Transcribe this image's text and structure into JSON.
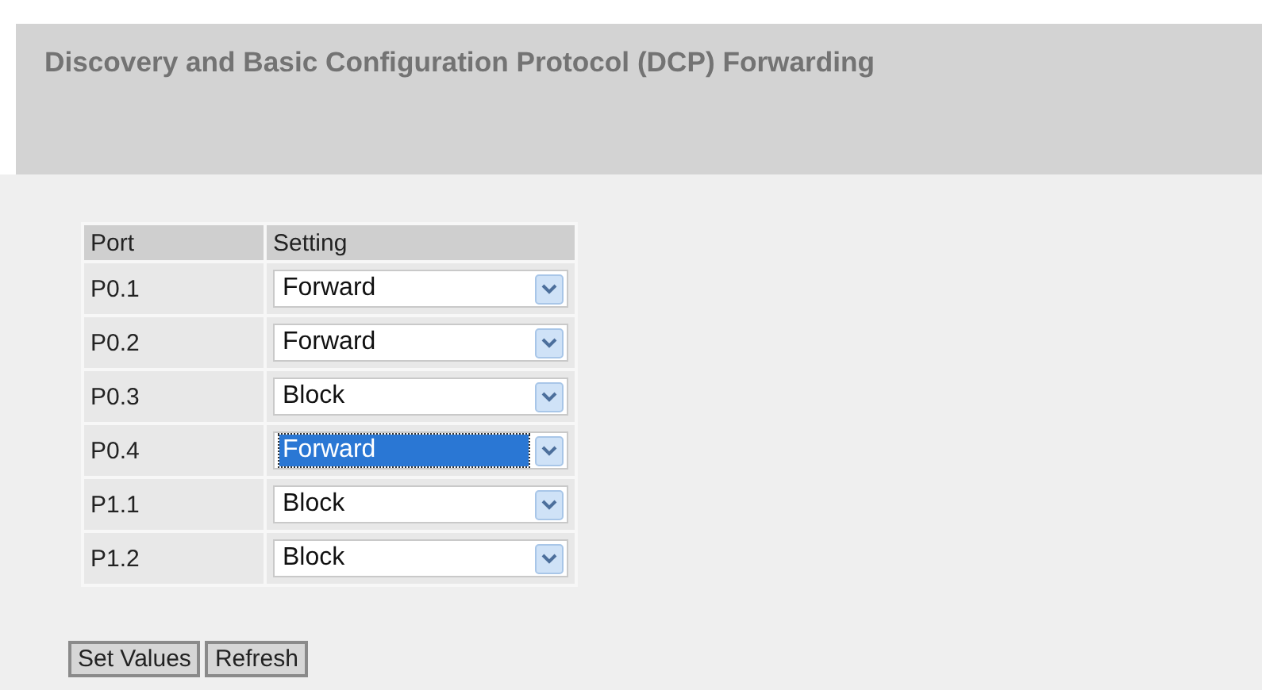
{
  "title": "Discovery and Basic Configuration Protocol (DCP) Forwarding",
  "table": {
    "columns": [
      "Port",
      "Setting"
    ],
    "rows": [
      {
        "port": "P0.1",
        "setting": "Forward",
        "focused": false
      },
      {
        "port": "P0.2",
        "setting": "Forward",
        "focused": false
      },
      {
        "port": "P0.3",
        "setting": "Block",
        "focused": false
      },
      {
        "port": "P0.4",
        "setting": "Forward",
        "focused": true
      },
      {
        "port": "P1.1",
        "setting": "Block",
        "focused": false
      },
      {
        "port": "P1.2",
        "setting": "Block",
        "focused": false
      }
    ]
  },
  "buttons": [
    "Set Values",
    "Refresh"
  ]
}
